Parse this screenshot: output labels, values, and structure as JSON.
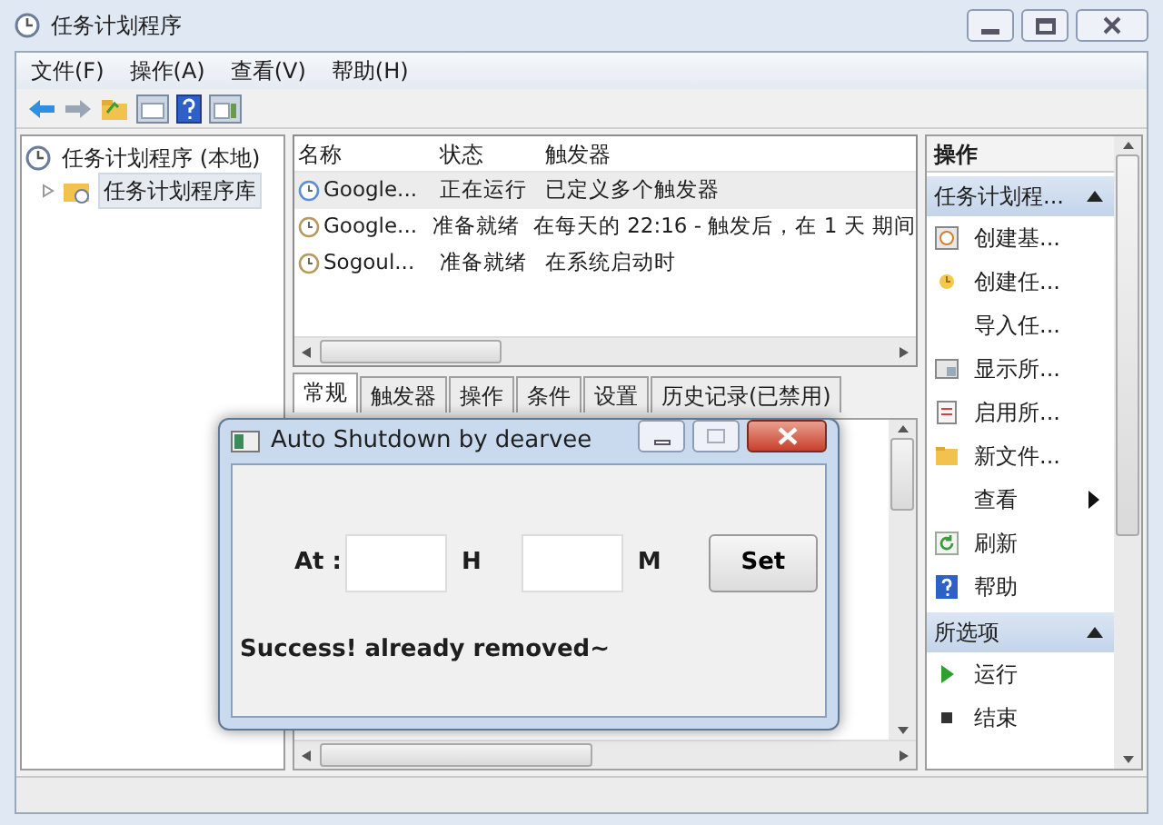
{
  "window": {
    "title": "任务计划程序"
  },
  "menu": [
    "文件(F)",
    "操作(A)",
    "查看(V)",
    "帮助(H)"
  ],
  "tree": [
    {
      "label": "任务计划程序 (本地)",
      "selected": false,
      "children": [
        {
          "label": "任务计划程序库",
          "selected": true,
          "expanded": false
        }
      ]
    }
  ],
  "tasks": {
    "columns": [
      "名称",
      "状态",
      "触发器"
    ],
    "rows": [
      {
        "cells": [
          "Google...",
          "正在运行",
          "已定义多个触发器"
        ],
        "selected": true
      },
      {
        "cells": [
          "Google...",
          "准备就绪",
          "在每天的 22:16 - 触发后，在 1 天 期间"
        ],
        "selected": false
      },
      {
        "cells": [
          "Sogoul...",
          "准备就绪",
          "在系统启动时"
        ],
        "selected": false
      }
    ]
  },
  "tabs": [
    {
      "label": "常规",
      "selected": true
    },
    {
      "label": "触发器",
      "selected": false
    },
    {
      "label": "操作",
      "selected": false
    },
    {
      "label": "条件",
      "selected": false
    },
    {
      "label": "设置",
      "selected": false
    },
    {
      "label": "历史记录(已禁用)",
      "selected": false
    }
  ],
  "actions": {
    "title": "操作",
    "sections": [
      {
        "title": "任务计划程...",
        "expanded": true,
        "items": [
          {
            "label": "创建基...",
            "submenu": false
          },
          {
            "label": "创建任...",
            "submenu": false
          },
          {
            "label": "导入任...",
            "submenu": false
          },
          {
            "label": "显示所...",
            "submenu": false
          },
          {
            "label": "启用所...",
            "submenu": false
          },
          {
            "label": "新文件...",
            "submenu": false
          },
          {
            "label": "查看",
            "submenu": true
          },
          {
            "label": "刷新",
            "submenu": false
          },
          {
            "label": "帮助",
            "submenu": false
          }
        ]
      },
      {
        "title": "所选项",
        "expanded": true,
        "items": [
          {
            "label": "运行",
            "submenu": false
          },
          {
            "label": "结束",
            "submenu": false
          }
        ]
      }
    ]
  },
  "dialog": {
    "title": "Auto Shutdown by dearvee",
    "at_label": "At :",
    "hour_label": "H",
    "minute_label": "M",
    "button": "Set",
    "message": "Success! already removed~"
  }
}
